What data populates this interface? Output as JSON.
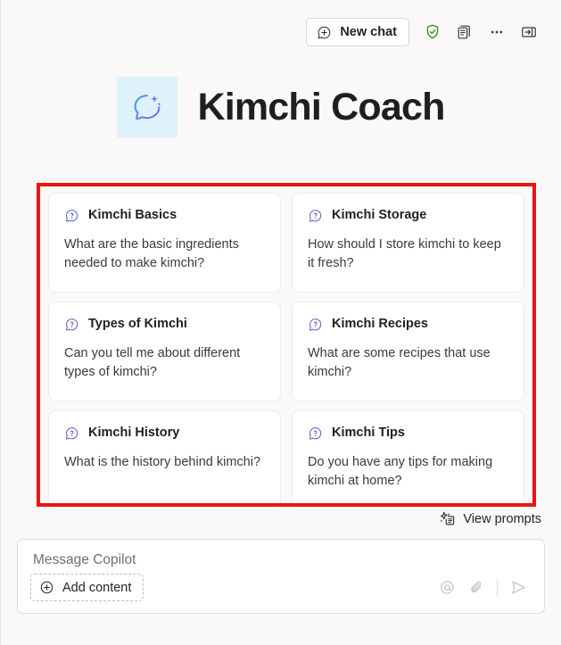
{
  "app": {
    "title": "Kimchi Coach",
    "logo_icon": "chat-sparkle-icon",
    "logo_bg": "#ddf2fb",
    "background": "#faf9f8"
  },
  "toolbar": {
    "new_chat_label": "New chat",
    "new_chat_icon": "chat-add-icon",
    "items": [
      {
        "icon": "shield-checkmark-icon",
        "color": "#3f8a29"
      },
      {
        "icon": "pages-icon",
        "color": "#3b3a39"
      },
      {
        "icon": "more-options-icon",
        "color": "#3b3a39"
      },
      {
        "icon": "expand-panel-icon",
        "color": "#3b3a39"
      }
    ]
  },
  "annotation": {
    "color": "#e81515",
    "thickness": "4px"
  },
  "prompt_cards": [
    {
      "icon": "question-chat-icon",
      "title": "Kimchi Basics",
      "body": "What are the basic ingredients needed to make kimchi?"
    },
    {
      "icon": "question-chat-icon",
      "title": "Kimchi Storage",
      "body": "How should I store kimchi to keep it fresh?"
    },
    {
      "icon": "question-chat-icon",
      "title": "Types of Kimchi",
      "body": "Can you tell me about different types of kimchi?"
    },
    {
      "icon": "question-chat-icon",
      "title": "Kimchi Recipes",
      "body": "What are some recipes that use kimchi?"
    },
    {
      "icon": "question-chat-icon",
      "title": "Kimchi History",
      "body": "What is the history behind kimchi?"
    },
    {
      "icon": "question-chat-icon",
      "title": "Kimchi Tips",
      "body": "Do you have any tips for making kimchi at home?"
    }
  ],
  "view_prompts": {
    "label": "View prompts",
    "icon": "prompt-sparkle-icon"
  },
  "composer": {
    "placeholder": "Message Copilot",
    "add_content_label": "Add content",
    "add_content_icon": "plus-circle-icon",
    "actions": [
      {
        "icon": "mention-icon"
      },
      {
        "icon": "attach-paperclip-icon"
      },
      {
        "icon": "send-icon"
      }
    ]
  }
}
